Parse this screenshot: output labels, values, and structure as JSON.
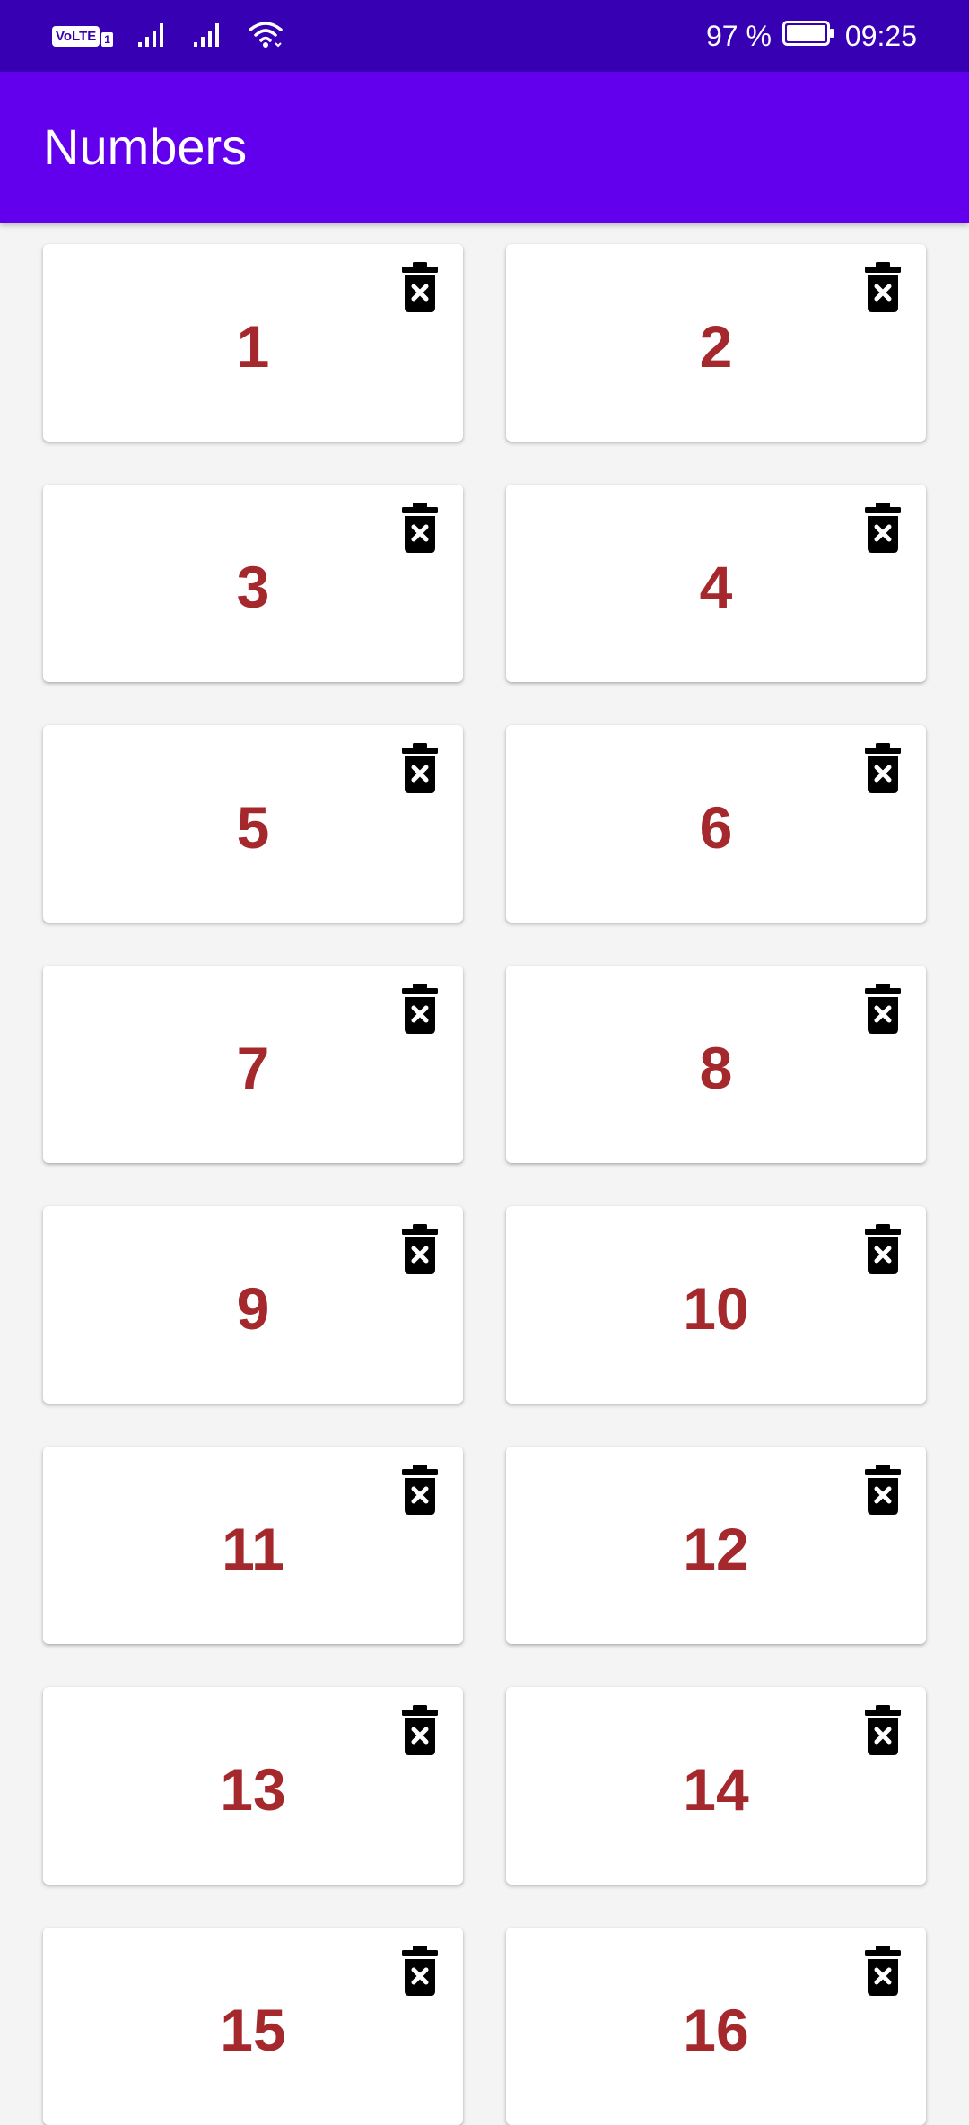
{
  "status_bar": {
    "volte": "VoLTE",
    "sim_slot": "1",
    "battery_percent": "97 %",
    "time": "09:25",
    "icons": [
      "volte-icon",
      "signal-icon",
      "signal-icon",
      "wifi-icon",
      "battery-icon"
    ]
  },
  "app_bar": {
    "title": "Numbers",
    "background": "#6200ee"
  },
  "colors": {
    "status_bar": "#3700b3",
    "number_text": "#a4282c",
    "page_background": "#f4f4f4",
    "card": "#ffffff"
  },
  "cards": [
    {
      "number": "1",
      "action_icon": "delete-icon"
    },
    {
      "number": "2",
      "action_icon": "delete-icon"
    },
    {
      "number": "3",
      "action_icon": "delete-icon"
    },
    {
      "number": "4",
      "action_icon": "delete-icon"
    },
    {
      "number": "5",
      "action_icon": "delete-icon"
    },
    {
      "number": "6",
      "action_icon": "delete-icon"
    },
    {
      "number": "7",
      "action_icon": "delete-icon"
    },
    {
      "number": "8",
      "action_icon": "delete-icon"
    },
    {
      "number": "9",
      "action_icon": "delete-icon"
    },
    {
      "number": "10",
      "action_icon": "delete-icon"
    },
    {
      "number": "11",
      "action_icon": "delete-icon"
    },
    {
      "number": "12",
      "action_icon": "delete-icon"
    },
    {
      "number": "13",
      "action_icon": "delete-icon"
    },
    {
      "number": "14",
      "action_icon": "delete-icon"
    },
    {
      "number": "15",
      "action_icon": "delete-icon"
    },
    {
      "number": "16",
      "action_icon": "delete-icon"
    }
  ]
}
